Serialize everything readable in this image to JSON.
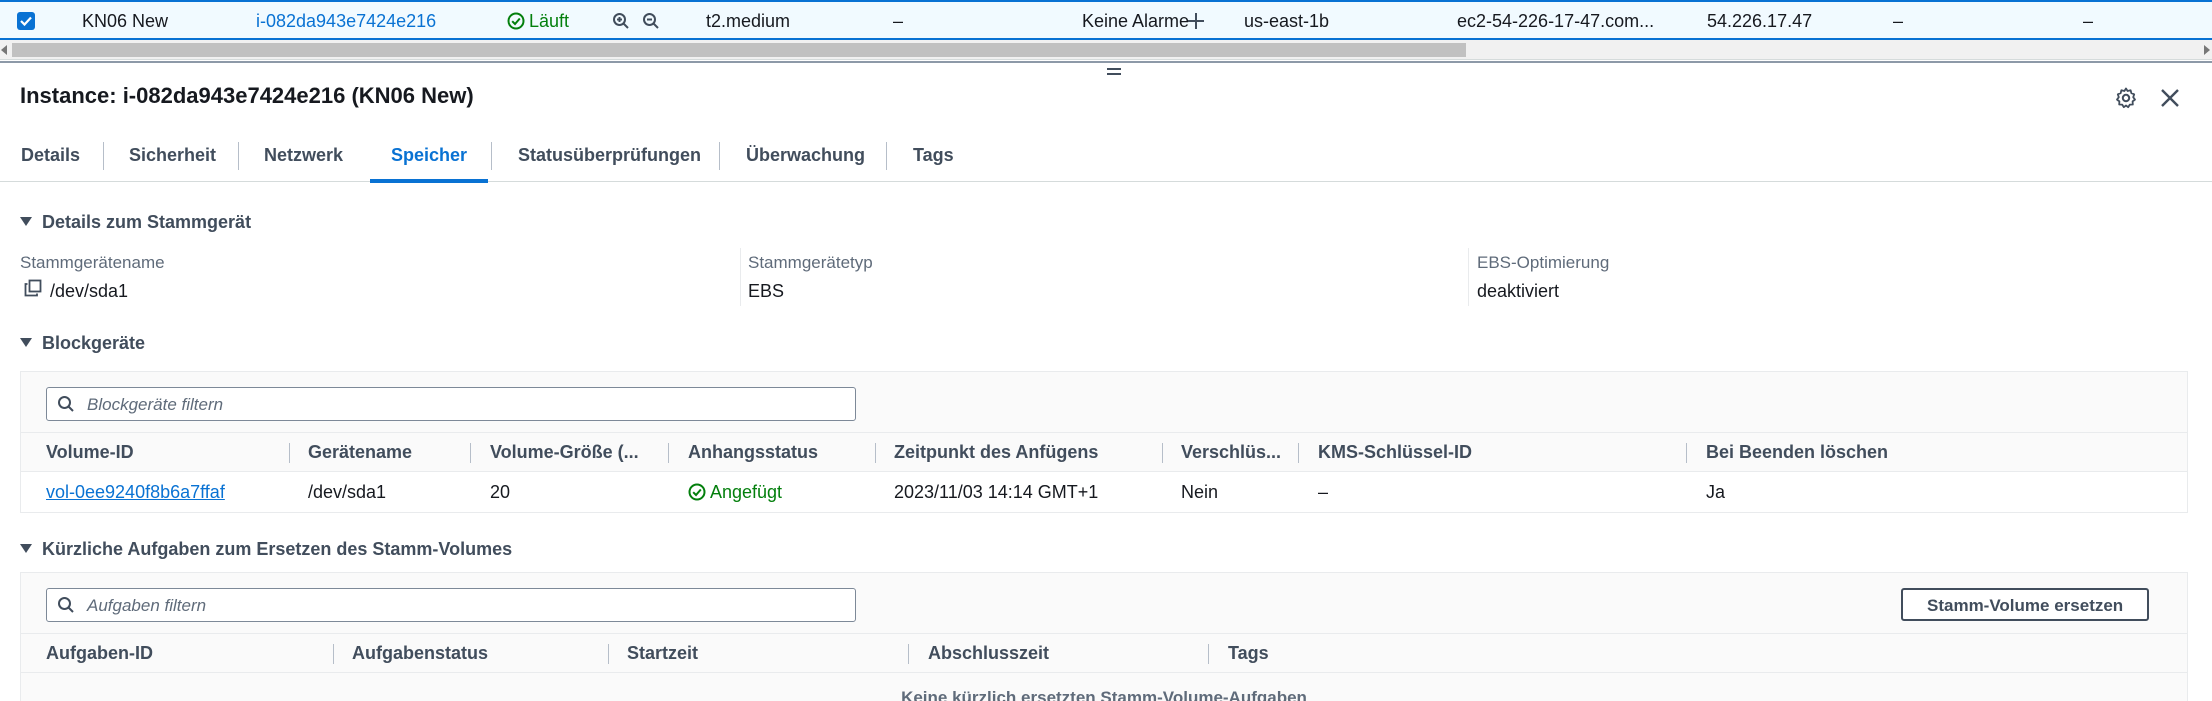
{
  "instance_row": {
    "name": "KN06 New",
    "instance_id": "i-082da943e7424e216",
    "state": "Läuft",
    "type": "t2.medium",
    "status_check": "–",
    "alarm": "Keine Alarme",
    "az": "us-east-1b",
    "public_dns": "ec2-54-226-17-47.com...",
    "public_ip": "54.226.17.47",
    "elastic_ip": "–",
    "ipv6": "–"
  },
  "panel": {
    "title": "Instance: i-082da943e7424e216 (KN06 New)"
  },
  "tabs": [
    {
      "label": "Details"
    },
    {
      "label": "Sicherheit"
    },
    {
      "label": "Netzwerk"
    },
    {
      "label": "Speicher"
    },
    {
      "label": "Statusüberprüfungen"
    },
    {
      "label": "Überwachung"
    },
    {
      "label": "Tags"
    }
  ],
  "active_tab": "Speicher",
  "root_device": {
    "heading": "Details zum Stammgerät",
    "name_label": "Stammgerätename",
    "name_value": "/dev/sda1",
    "type_label": "Stammgerätetyp",
    "type_value": "EBS",
    "ebs_label": "EBS-Optimierung",
    "ebs_value": "deaktiviert"
  },
  "block_devices": {
    "heading": "Blockgeräte",
    "filter_placeholder": "Blockgeräte filtern",
    "columns": [
      "Volume-ID",
      "Gerätename",
      "Volume-Größe (...",
      "Anhangsstatus",
      "Zeitpunkt des Anfügens",
      "Verschlüs...",
      "KMS-Schlüssel-ID",
      "Bei Beenden löschen"
    ],
    "rows": [
      {
        "volume_id": "vol-0ee9240f8b6a7ffaf",
        "device": "/dev/sda1",
        "size": "20",
        "status": "Angefügt",
        "attach_time": "2023/11/03 14:14 GMT+1",
        "encrypted": "Nein",
        "kms": "–",
        "delete_on_term": "Ja"
      }
    ]
  },
  "replace_tasks": {
    "heading": "Kürzliche Aufgaben zum Ersetzen des Stamm-Volumes",
    "filter_placeholder": "Aufgaben filtern",
    "button_label": "Stamm-Volume ersetzen",
    "columns": [
      "Aufgaben-ID",
      "Aufgabenstatus",
      "Startzeit",
      "Abschlusszeit",
      "Tags"
    ],
    "empty_text": "Keine kürzlich ersetzten Stamm-Volume-Aufgaben"
  },
  "colors": {
    "accent": "#0972d3",
    "success": "#037f0c",
    "text": "#16191f",
    "muted": "#5f6b7a"
  }
}
